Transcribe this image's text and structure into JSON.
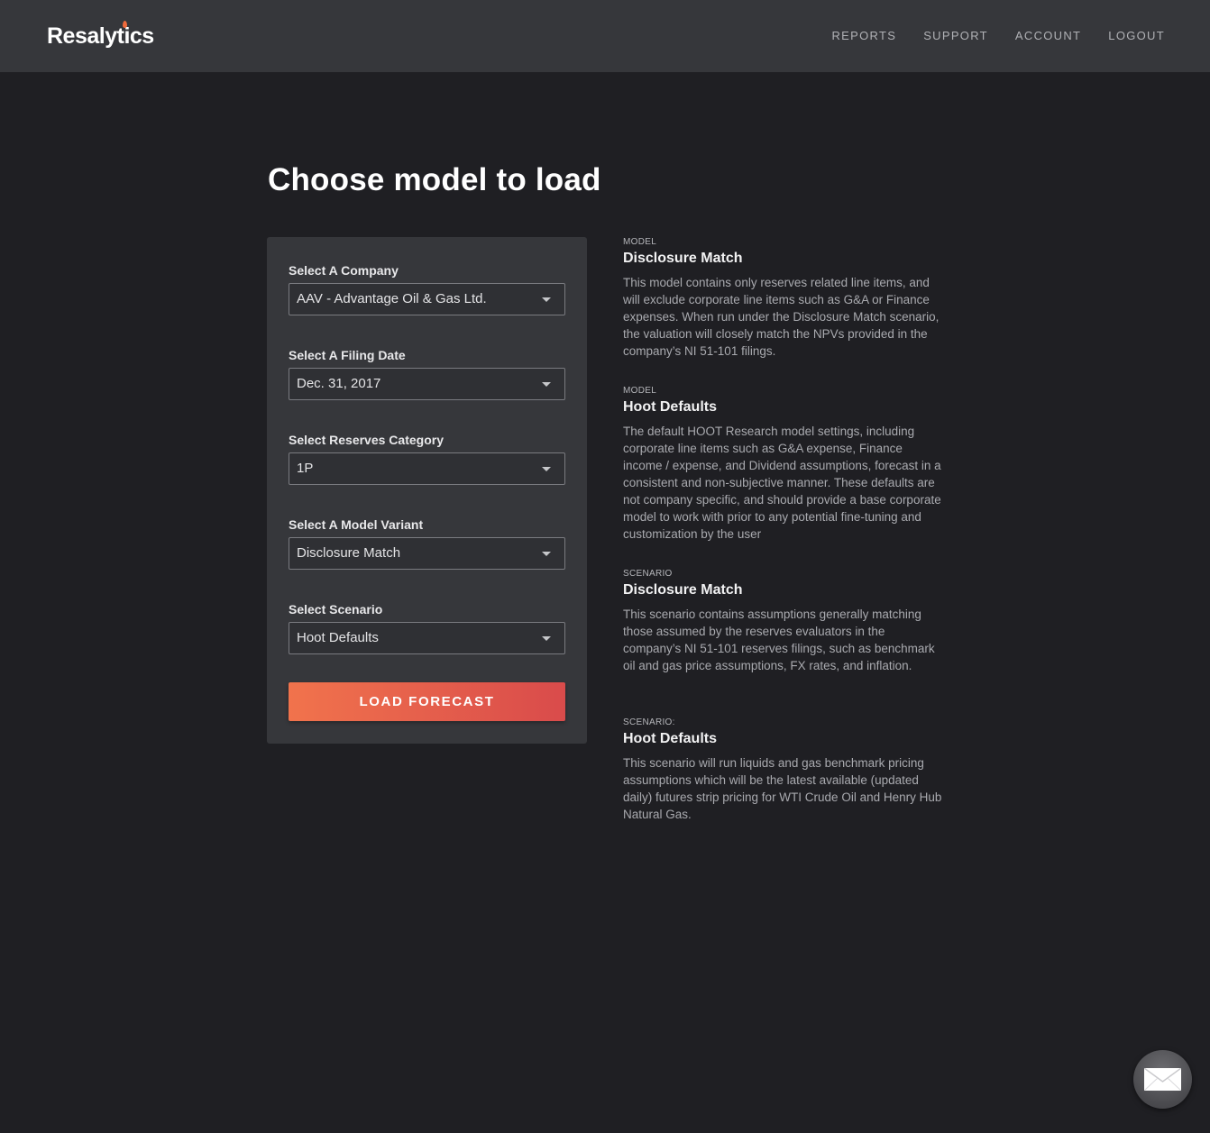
{
  "header": {
    "logo_text": "Resalytics",
    "nav": [
      {
        "label": "REPORTS"
      },
      {
        "label": "SUPPORT"
      },
      {
        "label": "ACCOUNT"
      },
      {
        "label": "LOGOUT"
      }
    ]
  },
  "main": {
    "title": "Choose model to load",
    "form": {
      "company": {
        "label": "Select A Company",
        "value": "AAV - Advantage Oil & Gas Ltd."
      },
      "filing_date": {
        "label": "Select A Filing Date",
        "value": "Dec. 31, 2017"
      },
      "reserves_category": {
        "label": "Select Reserves Category",
        "value": "1P"
      },
      "model_variant": {
        "label": "Select A Model Variant",
        "value": "Disclosure Match"
      },
      "scenario": {
        "label": "Select Scenario",
        "value": "Hoot Defaults"
      },
      "load_button": "LOAD FORECAST"
    },
    "info": [
      {
        "kicker": "MODEL",
        "title": "Disclosure Match",
        "body": "This model contains only reserves related line items, and will exclude corporate line items such as G&A or Finance expenses. When run under the Disclosure Match scenario, the valuation will closely match the NPVs provided in the company’s NI 51-101 filings."
      },
      {
        "kicker": "MODEL",
        "title": "Hoot Defaults",
        "body": "The default HOOT Research model settings, including corporate line items such as G&A expense, Finance income / expense, and Dividend assumptions, forecast in a consistent and non-subjective manner. These defaults are not company specific, and should provide a base corporate model to work with prior to any potential fine-tuning and customization by the user"
      },
      {
        "kicker": "SCENARIO",
        "title": "Disclosure Match",
        "body": "This scenario contains assumptions generally matching those assumed by the reserves evaluators in the company’s NI 51-101 reserves filings, such as benchmark oil and gas price assumptions, FX rates, and inflation."
      },
      {
        "kicker": "SCENARIO:",
        "title": "Hoot Defaults",
        "body": "This scenario will run liquids and gas benchmark pricing assumptions which will be the latest available (updated daily) futures strip pricing for WTI Crude Oil and Henry Hub Natural Gas."
      }
    ]
  },
  "chat_widget": {
    "icon": "mail-icon"
  },
  "colors": {
    "background": "#1f1f23",
    "header": "#36373b",
    "card": "#36373b",
    "accent_start": "#f1734c",
    "accent_end": "#d94b4b"
  }
}
